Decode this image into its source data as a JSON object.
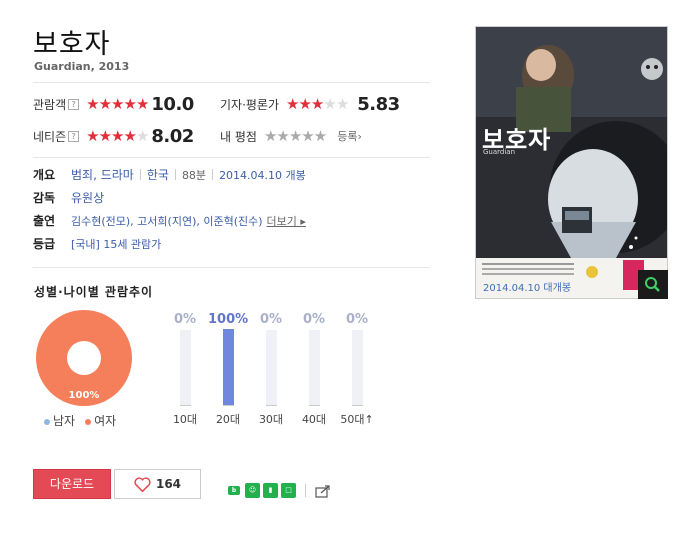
{
  "movie": {
    "title": "보호자",
    "subtitle": "Guardian, 2013"
  },
  "ratings": {
    "audience": {
      "label": "관람객",
      "help": "?",
      "stars": 5,
      "score": "10.0"
    },
    "critics": {
      "label": "기자·평론가",
      "stars": 3,
      "score": "5.83"
    },
    "netizen": {
      "label": "네티즌",
      "help": "?",
      "stars": 4,
      "score": "8.02"
    },
    "mine": {
      "label": "내 평점",
      "stars": 0,
      "enroll": "등록›"
    }
  },
  "info": {
    "overview": {
      "label": "개요",
      "genre": "범죄, 드라마",
      "country": "한국",
      "runtime": "88분",
      "release": "2014.04.10 개봉"
    },
    "director": {
      "label": "감독",
      "name": "유원상"
    },
    "cast": {
      "label": "출연",
      "members": "김수현(전모), 고서희(지연), 이준혁(진수)",
      "more": "더보기 ▸"
    },
    "rating": {
      "label": "등급",
      "value": "[국내] 15세 관람가"
    }
  },
  "demographics": {
    "title": "성별·나이별 관람추이",
    "gender": {
      "male_label": "남자",
      "female_label": "여자",
      "male_pct": 0,
      "female_pct": 100,
      "pie_label": "100%",
      "male_color": "#8fb8e0",
      "female_color": "#f47f5a"
    },
    "ages": [
      {
        "label": "10대",
        "pct_text": "0%",
        "value": 0
      },
      {
        "label": "20대",
        "pct_text": "100%",
        "value": 100
      },
      {
        "label": "30대",
        "pct_text": "0%",
        "value": 0
      },
      {
        "label": "40대",
        "pct_text": "0%",
        "value": 0
      },
      {
        "label": "50대↑",
        "pct_text": "0%",
        "value": 0
      }
    ]
  },
  "actions": {
    "download_label": "다운로드",
    "like_count": "164"
  },
  "share": {
    "icons": [
      "blog-icon",
      "band-icon",
      "bookmark-icon",
      "memo-icon",
      "share-arrow-icon"
    ]
  },
  "poster": {
    "title": "보호자",
    "subtitle": "Guardian",
    "date_text": "2014.04.10 대개봉"
  },
  "colors": {
    "star_on": "#e22f3c",
    "download_bg": "#e44a55",
    "bar_fill": "#7087e0",
    "link": "#3b5ea8"
  }
}
